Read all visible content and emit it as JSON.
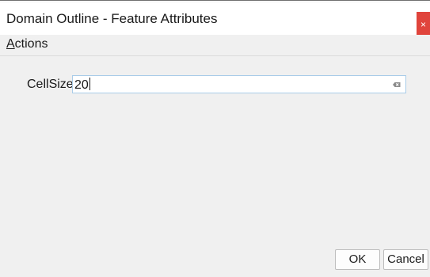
{
  "window": {
    "title": "Domain Outline - Feature Attributes",
    "close_label": "×"
  },
  "menu": {
    "items": [
      {
        "mnemonic": "A",
        "rest": "ctions"
      }
    ]
  },
  "form": {
    "fields": [
      {
        "label": "CellSize",
        "value": "20"
      }
    ]
  },
  "buttons": {
    "ok_label": "OK",
    "cancel_label": "Cancel"
  },
  "icons": {
    "close": "close-icon",
    "clear": "clear-text-icon"
  },
  "colors": {
    "close_button": "#e0443c",
    "input_border": "#a9cce8",
    "background": "#f0f0f0"
  }
}
